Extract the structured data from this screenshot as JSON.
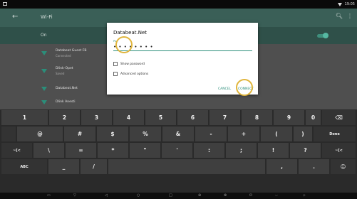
{
  "status_bar": {
    "time": "19:05"
  },
  "app_bar": {
    "back_glyph": "←",
    "title": "Wi-Fi",
    "search_glyph": "🔍︎",
    "more_glyph": "⋮"
  },
  "wifi_toggle_row": {
    "label": "On",
    "state": "on"
  },
  "networks": [
    {
      "name": "Databeat Guest FB",
      "status": "Connected"
    },
    {
      "name": "Dlink-Opet",
      "status": "Saved"
    },
    {
      "name": "Databeat.Net",
      "status": ""
    },
    {
      "name": "Dlink Anesti",
      "status": ""
    }
  ],
  "dialog": {
    "title": "Databeat.Net",
    "password_label": "Pa",
    "password_value": "• • • • • • • •",
    "show_password_label": "Show password",
    "advanced_options_label": "Advanced options",
    "cancel_label": "CANCEL",
    "connect_label": "CONNECT"
  },
  "keyboard": {
    "row1": [
      "1",
      "2",
      "3",
      "4",
      "5",
      "6",
      "7",
      "8",
      "9",
      "0",
      "⌫"
    ],
    "row2": [
      "@",
      "#",
      "$",
      "%",
      "&",
      "-",
      "+",
      "(",
      ")",
      "Done"
    ],
    "row3": [
      "~[<",
      "\\",
      "=",
      "*",
      "\"",
      "'",
      ":",
      ";",
      "!",
      "?",
      "~[<"
    ],
    "row4": [
      "ABC",
      "_",
      "/",
      "",
      ",",
      ".",
      "☺"
    ]
  },
  "nav_bar": [
    "▭",
    "▽",
    "◁",
    "○",
    "□",
    "⊕",
    "⊗",
    "⏻",
    "⌵",
    "⬦"
  ],
  "colors": {
    "accent": "#2b8e7a",
    "highlight_circle": "#e0b53c",
    "app_bar": "#3a5f57"
  }
}
